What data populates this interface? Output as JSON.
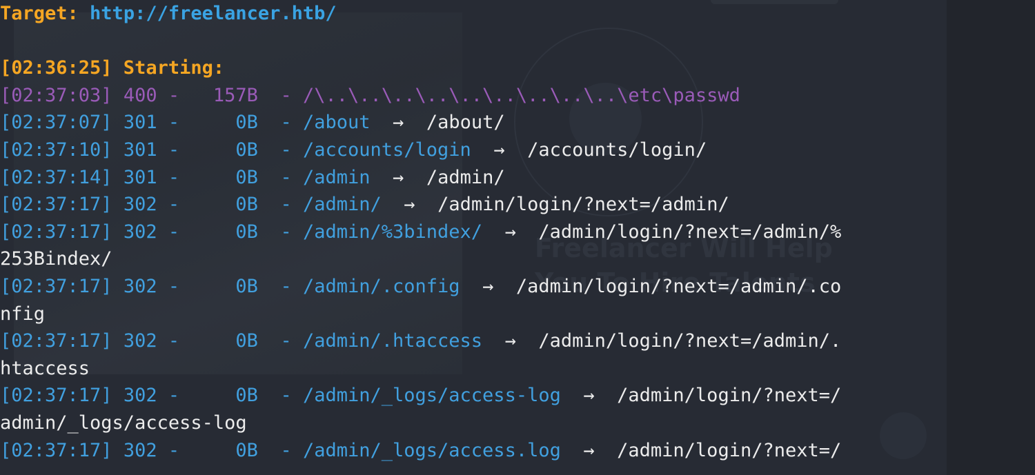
{
  "target": {
    "label": "Target: ",
    "url": "http://freelancer.htb/"
  },
  "starting": {
    "text": "[02:36:25] Starting:"
  },
  "results": [
    {
      "time": "[02:37:03]",
      "status": "400",
      "size": "157B",
      "path": "/\\..\\..\\..\\..\\..\\..\\..\\..\\..\\etc\\passwd",
      "redirect": "",
      "wrap": "",
      "style": "error"
    },
    {
      "time": "[02:37:07]",
      "status": "301",
      "size": "0B",
      "path": "/about",
      "redirect": "/about/",
      "wrap": "",
      "style": "redirect"
    },
    {
      "time": "[02:37:10]",
      "status": "301",
      "size": "0B",
      "path": "/accounts/login",
      "redirect": "/accounts/login/",
      "wrap": "",
      "style": "redirect"
    },
    {
      "time": "[02:37:14]",
      "status": "301",
      "size": "0B",
      "path": "/admin",
      "redirect": "/admin/",
      "wrap": "",
      "style": "redirect"
    },
    {
      "time": "[02:37:17]",
      "status": "302",
      "size": "0B",
      "path": "/admin/",
      "redirect": "/admin/login/?next=/admin/",
      "wrap": "",
      "style": "redirect"
    },
    {
      "time": "[02:37:17]",
      "status": "302",
      "size": "0B",
      "path": "/admin/%3bindex/",
      "redirect": "/admin/login/?next=/admin/%",
      "wrap": "253Bindex/",
      "style": "redirect"
    },
    {
      "time": "[02:37:17]",
      "status": "302",
      "size": "0B",
      "path": "/admin/.config",
      "redirect": "/admin/login/?next=/admin/.co",
      "wrap": "nfig",
      "style": "redirect"
    },
    {
      "time": "[02:37:17]",
      "status": "302",
      "size": "0B",
      "path": "/admin/.htaccess",
      "redirect": "/admin/login/?next=/admin/.",
      "wrap": "htaccess",
      "style": "redirect"
    },
    {
      "time": "[02:37:17]",
      "status": "302",
      "size": "0B",
      "path": "/admin/_logs/access-log",
      "redirect": "/admin/login/?next=/",
      "wrap": "admin/_logs/access-log",
      "style": "redirect"
    },
    {
      "time": "[02:37:17]",
      "status": "302",
      "size": "0B",
      "path": "/admin/_logs/access.log",
      "redirect": "/admin/login/?next=/",
      "wrap": "",
      "style": "redirect"
    }
  ],
  "separators": {
    "dash": "-",
    "arrow": "→"
  },
  "background": {
    "heading_line1": "Freelancer Will Help",
    "heading_line2": "You To Hire Talents"
  },
  "colors": {
    "terminal_bg": "#272b34",
    "target_label": "#f5a623",
    "target_url": "#3aa3e3",
    "starting": "#f5a623",
    "error_line": "#9a5bb8",
    "redirect_line": "#41a0df",
    "redirect_target": "#ececec"
  }
}
